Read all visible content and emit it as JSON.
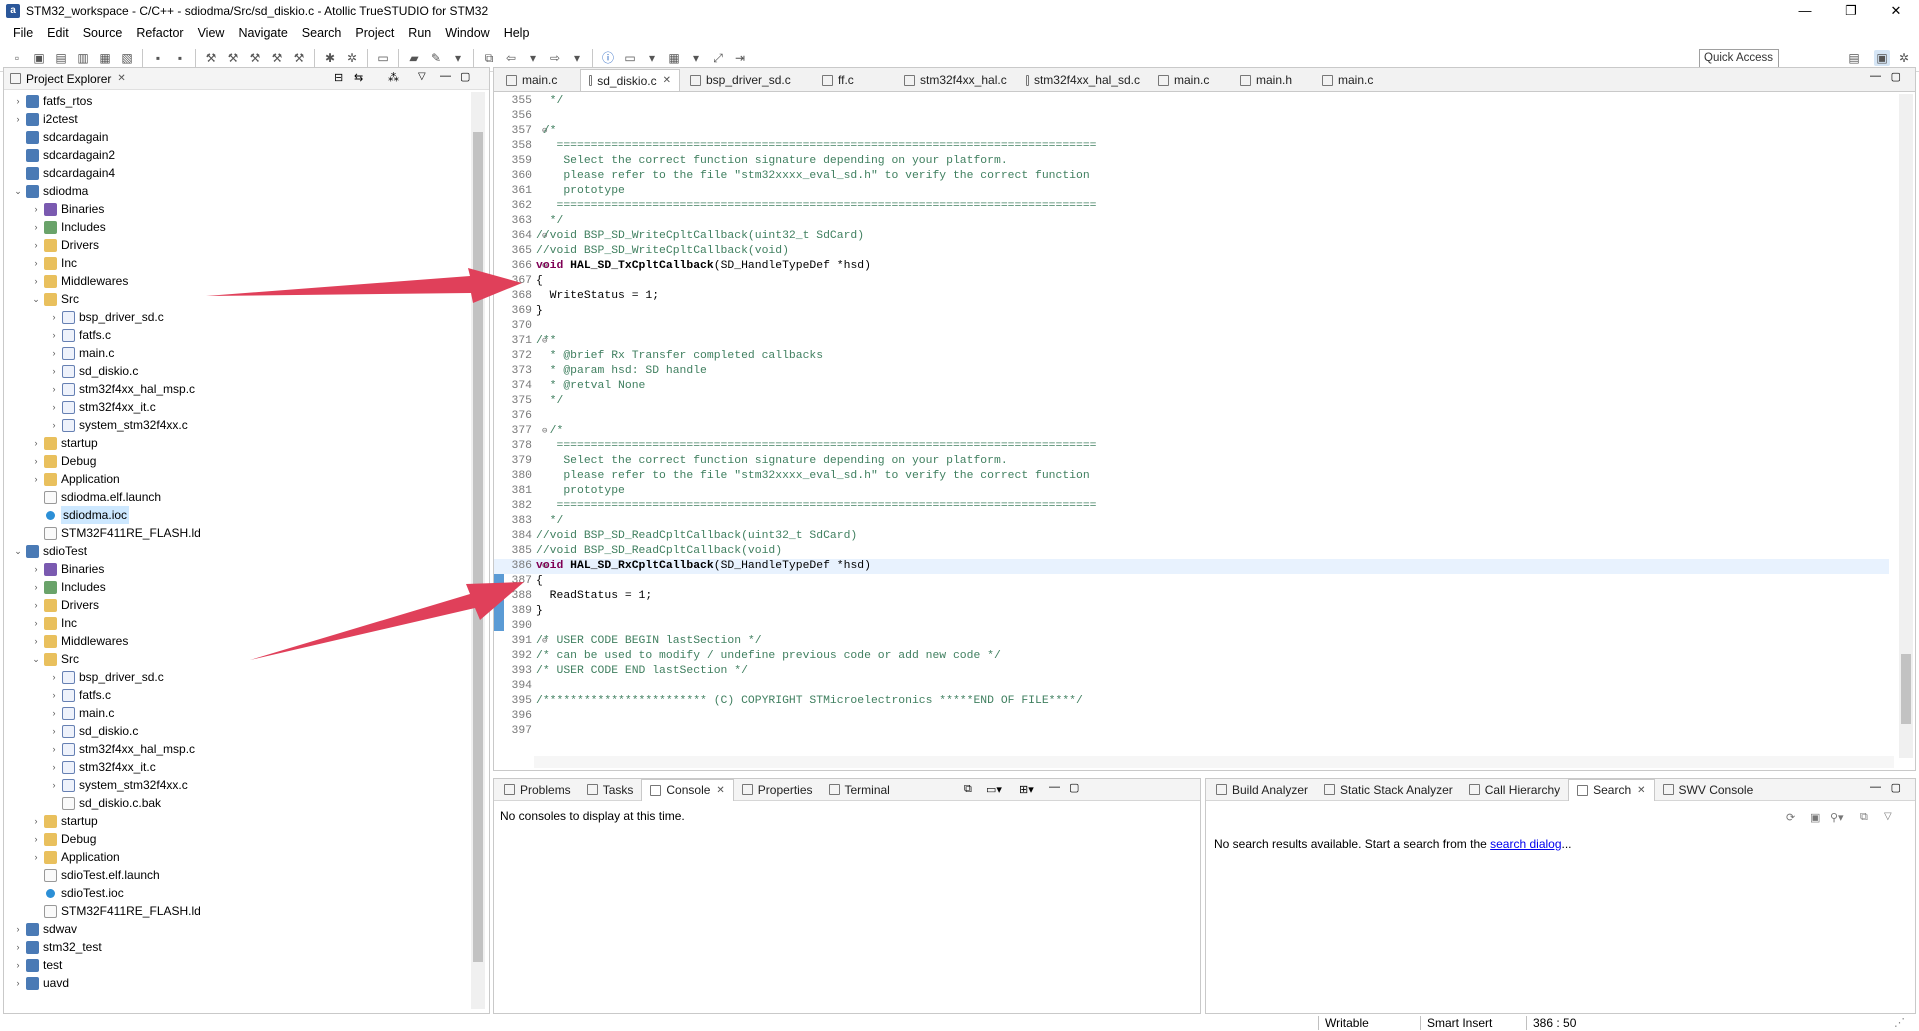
{
  "window": {
    "title": "STM32_workspace - C/C++ - sdiodma/Src/sd_diskio.c - Atollic TrueSTUDIO for STM32",
    "app_icon": "a",
    "controls": {
      "minimize": "—",
      "maximize": "❐",
      "close": "✕"
    }
  },
  "menu": [
    "File",
    "Edit",
    "Source",
    "Refactor",
    "View",
    "Navigate",
    "Search",
    "Project",
    "Run",
    "Window",
    "Help"
  ],
  "toolbar": {
    "quick_access": "Quick Access"
  },
  "explorer": {
    "title": "Project Explorer",
    "tree": [
      {
        "label": "fatfs_rtos",
        "depth": 0,
        "icon": "proj",
        "chev": "›"
      },
      {
        "label": "i2ctest",
        "depth": 0,
        "icon": "proj",
        "chev": "›"
      },
      {
        "label": "sdcardagain",
        "depth": 0,
        "icon": "proj",
        "chev": ""
      },
      {
        "label": "sdcardagain2",
        "depth": 0,
        "icon": "proj",
        "chev": ""
      },
      {
        "label": "sdcardagain4",
        "depth": 0,
        "icon": "proj",
        "chev": ""
      },
      {
        "label": "sdiodma",
        "depth": 0,
        "icon": "proj",
        "chev": "⌄"
      },
      {
        "label": "Binaries",
        "depth": 1,
        "icon": "bin",
        "chev": "›"
      },
      {
        "label": "Includes",
        "depth": 1,
        "icon": "inc",
        "chev": "›"
      },
      {
        "label": "Drivers",
        "depth": 1,
        "icon": "folder",
        "chev": "›"
      },
      {
        "label": "Inc",
        "depth": 1,
        "icon": "folder",
        "chev": "›"
      },
      {
        "label": "Middlewares",
        "depth": 1,
        "icon": "folder",
        "chev": "›"
      },
      {
        "label": "Src",
        "depth": 1,
        "icon": "folder",
        "chev": "⌄"
      },
      {
        "label": "bsp_driver_sd.c",
        "depth": 2,
        "icon": "cfile",
        "chev": "›"
      },
      {
        "label": "fatfs.c",
        "depth": 2,
        "icon": "cfile",
        "chev": "›"
      },
      {
        "label": "main.c",
        "depth": 2,
        "icon": "cfile",
        "chev": "›"
      },
      {
        "label": "sd_diskio.c",
        "depth": 2,
        "icon": "cfile",
        "chev": "›"
      },
      {
        "label": "stm32f4xx_hal_msp.c",
        "depth": 2,
        "icon": "cfile",
        "chev": "›"
      },
      {
        "label": "stm32f4xx_it.c",
        "depth": 2,
        "icon": "cfile",
        "chev": "›"
      },
      {
        "label": "system_stm32f4xx.c",
        "depth": 2,
        "icon": "cfile",
        "chev": "›"
      },
      {
        "label": "startup",
        "depth": 1,
        "icon": "folder",
        "chev": "›"
      },
      {
        "label": "Debug",
        "depth": 1,
        "icon": "folder",
        "chev": "›"
      },
      {
        "label": "Application",
        "depth": 1,
        "icon": "folder",
        "chev": "›"
      },
      {
        "label": "sdiodma.elf.launch",
        "depth": 1,
        "icon": "file",
        "chev": ""
      },
      {
        "label": "sdiodma.ioc",
        "depth": 1,
        "icon": "ioc",
        "chev": "",
        "selected": true
      },
      {
        "label": "STM32F411RE_FLASH.ld",
        "depth": 1,
        "icon": "file",
        "chev": ""
      },
      {
        "label": "sdioTest",
        "depth": 0,
        "icon": "proj",
        "chev": "⌄"
      },
      {
        "label": "Binaries",
        "depth": 1,
        "icon": "bin",
        "chev": "›"
      },
      {
        "label": "Includes",
        "depth": 1,
        "icon": "inc",
        "chev": "›"
      },
      {
        "label": "Drivers",
        "depth": 1,
        "icon": "folder",
        "chev": "›"
      },
      {
        "label": "Inc",
        "depth": 1,
        "icon": "folder",
        "chev": "›"
      },
      {
        "label": "Middlewares",
        "depth": 1,
        "icon": "folder",
        "chev": "›"
      },
      {
        "label": "Src",
        "depth": 1,
        "icon": "folder",
        "chev": "⌄"
      },
      {
        "label": "bsp_driver_sd.c",
        "depth": 2,
        "icon": "cfile",
        "chev": "›"
      },
      {
        "label": "fatfs.c",
        "depth": 2,
        "icon": "cfile",
        "chev": "›"
      },
      {
        "label": "main.c",
        "depth": 2,
        "icon": "cfile",
        "chev": "›"
      },
      {
        "label": "sd_diskio.c",
        "depth": 2,
        "icon": "cfile",
        "chev": "›"
      },
      {
        "label": "stm32f4xx_hal_msp.c",
        "depth": 2,
        "icon": "cfile",
        "chev": "›"
      },
      {
        "label": "stm32f4xx_it.c",
        "depth": 2,
        "icon": "cfile",
        "chev": "›"
      },
      {
        "label": "system_stm32f4xx.c",
        "depth": 2,
        "icon": "cfile",
        "chev": "›"
      },
      {
        "label": "sd_diskio.c.bak",
        "depth": 2,
        "icon": "file",
        "chev": ""
      },
      {
        "label": "startup",
        "depth": 1,
        "icon": "folder",
        "chev": "›"
      },
      {
        "label": "Debug",
        "depth": 1,
        "icon": "folder",
        "chev": "›"
      },
      {
        "label": "Application",
        "depth": 1,
        "icon": "folder",
        "chev": "›"
      },
      {
        "label": "sdioTest.elf.launch",
        "depth": 1,
        "icon": "file",
        "chev": ""
      },
      {
        "label": "sdioTest.ioc",
        "depth": 1,
        "icon": "ioc",
        "chev": ""
      },
      {
        "label": "STM32F411RE_FLASH.ld",
        "depth": 1,
        "icon": "file",
        "chev": ""
      },
      {
        "label": "sdwav",
        "depth": 0,
        "icon": "proj",
        "chev": "›"
      },
      {
        "label": "stm32_test",
        "depth": 0,
        "icon": "proj",
        "chev": "›"
      },
      {
        "label": "test",
        "depth": 0,
        "icon": "proj",
        "chev": "›"
      },
      {
        "label": "uavd",
        "depth": 0,
        "icon": "proj",
        "chev": "›"
      }
    ]
  },
  "editor": {
    "tabs": [
      {
        "label": "main.c",
        "active": false
      },
      {
        "label": "sd_diskio.c",
        "active": true
      },
      {
        "label": "bsp_driver_sd.c",
        "active": false
      },
      {
        "label": "ff.c",
        "active": false
      },
      {
        "label": "stm32f4xx_hal.c",
        "active": false
      },
      {
        "label": "stm32f4xx_hal_sd.c",
        "active": false
      },
      {
        "label": "main.c",
        "active": false
      },
      {
        "label": "main.h",
        "active": false
      },
      {
        "label": "main.c",
        "active": false
      }
    ],
    "lines": [
      {
        "n": "355",
        "fold": "",
        "t": "  */",
        "c": "cm"
      },
      {
        "n": "356",
        "fold": "",
        "t": "",
        "c": ""
      },
      {
        "n": "357",
        "fold": "⊖",
        "t": " /*",
        "c": "cm"
      },
      {
        "n": "358",
        "fold": "",
        "t": "   ===============================================================================",
        "c": "cm"
      },
      {
        "n": "359",
        "fold": "",
        "t": "    Select the correct function signature depending on your platform.",
        "c": "cm"
      },
      {
        "n": "360",
        "fold": "",
        "t": "    please refer to the file \"stm32xxxx_eval_sd.h\" to verify the correct function",
        "c": "cm"
      },
      {
        "n": "361",
        "fold": "",
        "t": "    prototype",
        "c": "cm"
      },
      {
        "n": "362",
        "fold": "",
        "t": "   ===============================================================================",
        "c": "cm"
      },
      {
        "n": "363",
        "fold": "",
        "t": "  */",
        "c": "cm"
      },
      {
        "n": "364",
        "fold": "⊖",
        "t": "//void BSP_SD_WriteCpltCallback(uint32_t SdCard)",
        "c": "cm"
      },
      {
        "n": "365",
        "fold": "",
        "t": "//void BSP_SD_WriteCpltCallback(void)",
        "c": "cm"
      },
      {
        "n": "366",
        "fold": "⊖",
        "t": "void HAL_SD_TxCpltCallback(SD_HandleTypeDef *hsd)",
        "c": "sig"
      },
      {
        "n": "367",
        "fold": "",
        "t": "{",
        "c": ""
      },
      {
        "n": "368",
        "fold": "",
        "t": "  WriteStatus = 1;",
        "c": ""
      },
      {
        "n": "369",
        "fold": "",
        "t": "}",
        "c": ""
      },
      {
        "n": "370",
        "fold": "",
        "t": "",
        "c": ""
      },
      {
        "n": "371",
        "fold": "⊖",
        "t": "/**",
        "c": "cm"
      },
      {
        "n": "372",
        "fold": "",
        "t": "  * @brief Rx Transfer completed callbacks",
        "c": "cm"
      },
      {
        "n": "373",
        "fold": "",
        "t": "  * @param hsd: SD handle",
        "c": "cm"
      },
      {
        "n": "374",
        "fold": "",
        "t": "  * @retval None",
        "c": "cm"
      },
      {
        "n": "375",
        "fold": "",
        "t": "  */",
        "c": "cm"
      },
      {
        "n": "376",
        "fold": "",
        "t": "",
        "c": ""
      },
      {
        "n": "377",
        "fold": "⊖",
        "t": "  /*",
        "c": "cm"
      },
      {
        "n": "378",
        "fold": "",
        "t": "   ===============================================================================",
        "c": "cm"
      },
      {
        "n": "379",
        "fold": "",
        "t": "    Select the correct function signature depending on your platform.",
        "c": "cm"
      },
      {
        "n": "380",
        "fold": "",
        "t": "    please refer to the file \"stm32xxxx_eval_sd.h\" to verify the correct function",
        "c": "cm"
      },
      {
        "n": "381",
        "fold": "",
        "t": "    prototype",
        "c": "cm"
      },
      {
        "n": "382",
        "fold": "",
        "t": "   ===============================================================================",
        "c": "cm"
      },
      {
        "n": "383",
        "fold": "",
        "t": "  */",
        "c": "cm"
      },
      {
        "n": "384",
        "fold": "",
        "t": "//void BSP_SD_ReadCpltCallback(uint32_t SdCard)",
        "c": "cm"
      },
      {
        "n": "385",
        "fold": "",
        "t": "//void BSP_SD_ReadCpltCallback(void)",
        "c": "cm"
      },
      {
        "n": "386",
        "fold": "⊖",
        "t": "void HAL_SD_RxCpltCallback(SD_HandleTypeDef *hsd)",
        "c": "sig",
        "cur": true
      },
      {
        "n": "387",
        "fold": "",
        "t": "{",
        "c": ""
      },
      {
        "n": "388",
        "fold": "",
        "t": "  ReadStatus = 1;",
        "c": ""
      },
      {
        "n": "389",
        "fold": "",
        "t": "}",
        "c": ""
      },
      {
        "n": "390",
        "fold": "",
        "t": "",
        "c": ""
      },
      {
        "n": "391",
        "fold": "⊖",
        "t": "/* USER CODE BEGIN lastSection */",
        "c": "cm"
      },
      {
        "n": "392",
        "fold": "",
        "t": "/* can be used to modify / undefine previous code or add new code */",
        "c": "cm"
      },
      {
        "n": "393",
        "fold": "",
        "t": "/* USER CODE END lastSection */",
        "c": "cm"
      },
      {
        "n": "394",
        "fold": "",
        "t": "",
        "c": ""
      },
      {
        "n": "395",
        "fold": "",
        "t": "/************************ (C) COPYRIGHT STMicroelectronics *****END OF FILE****/",
        "c": "cm"
      },
      {
        "n": "396",
        "fold": "",
        "t": "",
        "c": ""
      },
      {
        "n": "397",
        "fold": "",
        "t": "",
        "c": ""
      }
    ]
  },
  "bottom_left": {
    "tabs": [
      {
        "label": "Problems",
        "active": false
      },
      {
        "label": "Tasks",
        "active": false
      },
      {
        "label": "Console",
        "active": true
      },
      {
        "label": "Properties",
        "active": false
      },
      {
        "label": "Terminal",
        "active": false
      }
    ],
    "message": "No consoles to display at this time."
  },
  "bottom_right": {
    "tabs": [
      {
        "label": "Build Analyzer",
        "active": false
      },
      {
        "label": "Static Stack Analyzer",
        "active": false
      },
      {
        "label": "Call Hierarchy",
        "active": false
      },
      {
        "label": "Search",
        "active": true
      },
      {
        "label": "SWV Console",
        "active": false
      }
    ],
    "message_prefix": "No search results available. Start a search from the ",
    "message_link": "search dialog",
    "message_suffix": "..."
  },
  "status": {
    "writable": "Writable",
    "insert_mode": "Smart Insert",
    "position": "386 : 50"
  },
  "colors": {
    "arrow": "#e0405a",
    "comment": "#3f7f5f",
    "keyword": "#7f0055",
    "selection": "#cde8ff"
  }
}
